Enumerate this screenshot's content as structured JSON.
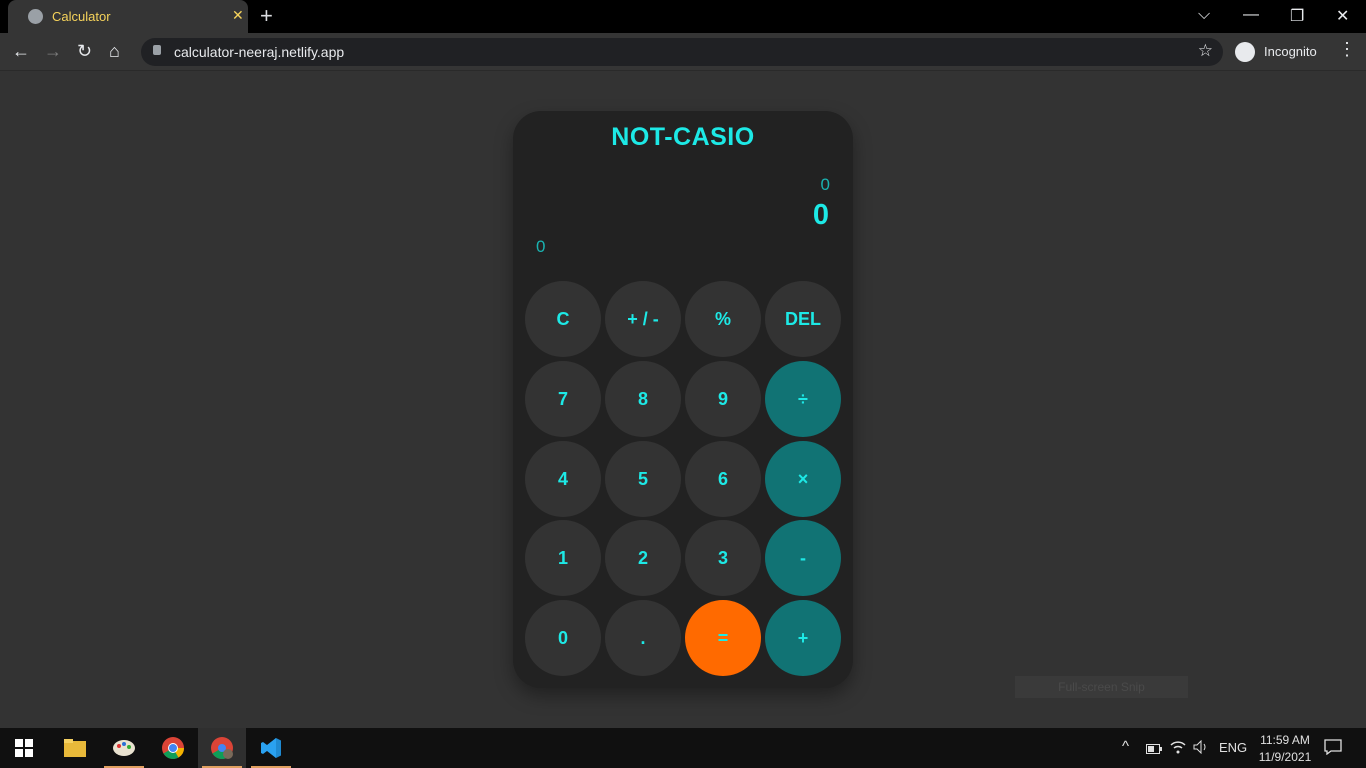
{
  "browser": {
    "tab_title": "Calculator",
    "tab_close": "✕",
    "new_tab": "+",
    "url": "calculator-neeraj.netlify.app",
    "profile_label": "Incognito",
    "window_controls": {
      "tabsearch": "⌵",
      "minimize": "—",
      "restore": "❐",
      "close": "✕"
    },
    "nav": {
      "back": "←",
      "forward": "→",
      "reload": "↻",
      "home": "⌂",
      "star": "☆",
      "menu": "⋮"
    }
  },
  "calculator": {
    "title": "NOT-CASIO",
    "previous_value": "0",
    "current_value": "0",
    "memory_value": "0",
    "keys": [
      {
        "label": "C",
        "kind": "fn"
      },
      {
        "label": "+ / -",
        "kind": "fn"
      },
      {
        "label": "%",
        "kind": "fn"
      },
      {
        "label": "DEL",
        "kind": "fn"
      },
      {
        "label": "7",
        "kind": "num"
      },
      {
        "label": "8",
        "kind": "num"
      },
      {
        "label": "9",
        "kind": "num"
      },
      {
        "label": "÷",
        "kind": "op"
      },
      {
        "label": "4",
        "kind": "num"
      },
      {
        "label": "5",
        "kind": "num"
      },
      {
        "label": "6",
        "kind": "num"
      },
      {
        "label": "×",
        "kind": "op"
      },
      {
        "label": "1",
        "kind": "num"
      },
      {
        "label": "2",
        "kind": "num"
      },
      {
        "label": "3",
        "kind": "num"
      },
      {
        "label": "-",
        "kind": "op"
      },
      {
        "label": "0",
        "kind": "num"
      },
      {
        "label": ".",
        "kind": "num"
      },
      {
        "label": "=",
        "kind": "eq"
      },
      {
        "label": "+",
        "kind": "op"
      }
    ],
    "colors": {
      "accent": "#1de9e6",
      "operator": "#117374",
      "equals": "#ff6a00",
      "body": "#222222",
      "key": "#333333"
    }
  },
  "overlay": {
    "watermark_text": "Full-screen Snip"
  },
  "taskbar": {
    "apps": [
      "windows-start-icon",
      "file-explorer-icon",
      "paint-icon",
      "chrome-icon",
      "chrome-profile-icon",
      "vscode-icon"
    ],
    "tray": {
      "chevron": "^",
      "language": "ENG"
    },
    "time": "11:59 AM",
    "date": "11/9/2021"
  }
}
